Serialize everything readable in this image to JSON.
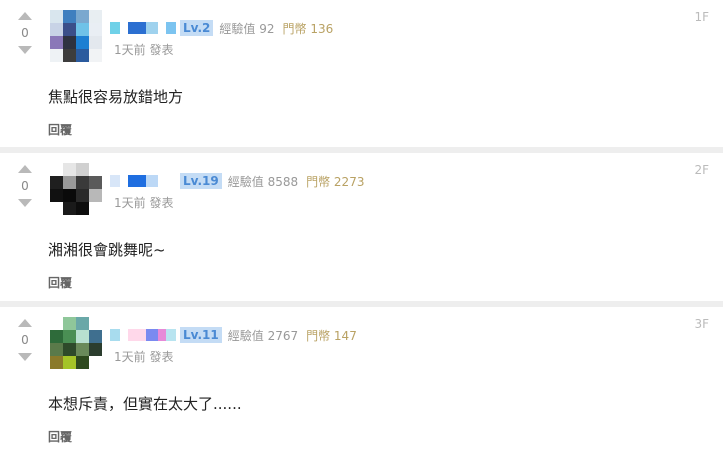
{
  "comments": [
    {
      "floor": "1F",
      "votes": "0",
      "level": "Lv.2",
      "exp": "經驗值 92",
      "coin": "門幣 136",
      "posted": "1天前 發表",
      "text": "焦點很容易放錯地方",
      "reply": "回覆",
      "avatar_colors": [
        "#d9e6ee",
        "#3f7fbf",
        "#7aa8cf",
        "#e8eef2",
        "#c8d3e6",
        "#3b4f8a",
        "#6fc2e8",
        "#e9eef4",
        "#8a78b8",
        "#2e3240",
        "#1d7fd2",
        "#e3e8ee",
        "#eef2f5",
        "#3d3d3d",
        "#2b5b9e",
        "#f1f3f5"
      ],
      "name_colors": [
        "#6fd1e8",
        "#ffffff",
        "#2b6fd1",
        "#9fd2ee",
        "#ffffff",
        "#7cc4f0"
      ]
    },
    {
      "floor": "2F",
      "votes": "0",
      "level": "Lv.19",
      "exp": "經驗值 8588",
      "coin": "門幣 2273",
      "posted": "1天前 發表",
      "text": "湘湘很會跳舞呢~",
      "reply": "回覆",
      "avatar_colors": [
        "#ffffff",
        "#e6e6e6",
        "#d0d0d0",
        "#ffffff",
        "#1f1f1f",
        "#9a9a9a",
        "#3a3a3a",
        "#5a5a5a",
        "#111111",
        "#0a0a0a",
        "#2a2a2a",
        "#b8b8b8",
        "#ffffff",
        "#1a1a1a",
        "#0d0d0d",
        "#ffffff"
      ],
      "name_colors": [
        "#d8e6f8",
        "#ffffff",
        "#1f6ee0",
        "#bcd8f6",
        "#ffffff",
        "#ffffff"
      ]
    },
    {
      "floor": "3F",
      "votes": "0",
      "level": "Lv.11",
      "exp": "經驗值 2767",
      "coin": "門幣 147",
      "posted": "1天前 發表",
      "text": "本想斥責，但實在太大了......",
      "reply": "回覆",
      "avatar_colors": [
        "#ffffff",
        "#8fc79a",
        "#6aa8a8",
        "#ffffff",
        "#2e6b3a",
        "#4a8f54",
        "#b8e0d0",
        "#3f6f8f",
        "#5a7a4a",
        "#2e4a2a",
        "#6a8a5a",
        "#2b3d2e",
        "#8a7a2a",
        "#a4c428",
        "#2e4a1e",
        "#ffffff"
      ],
      "name_colors": [
        "#a8dcee",
        "#ffffff",
        "#ffd8ea",
        "#7a8af0",
        "#e68ad8",
        "#b8e4f0"
      ]
    }
  ]
}
